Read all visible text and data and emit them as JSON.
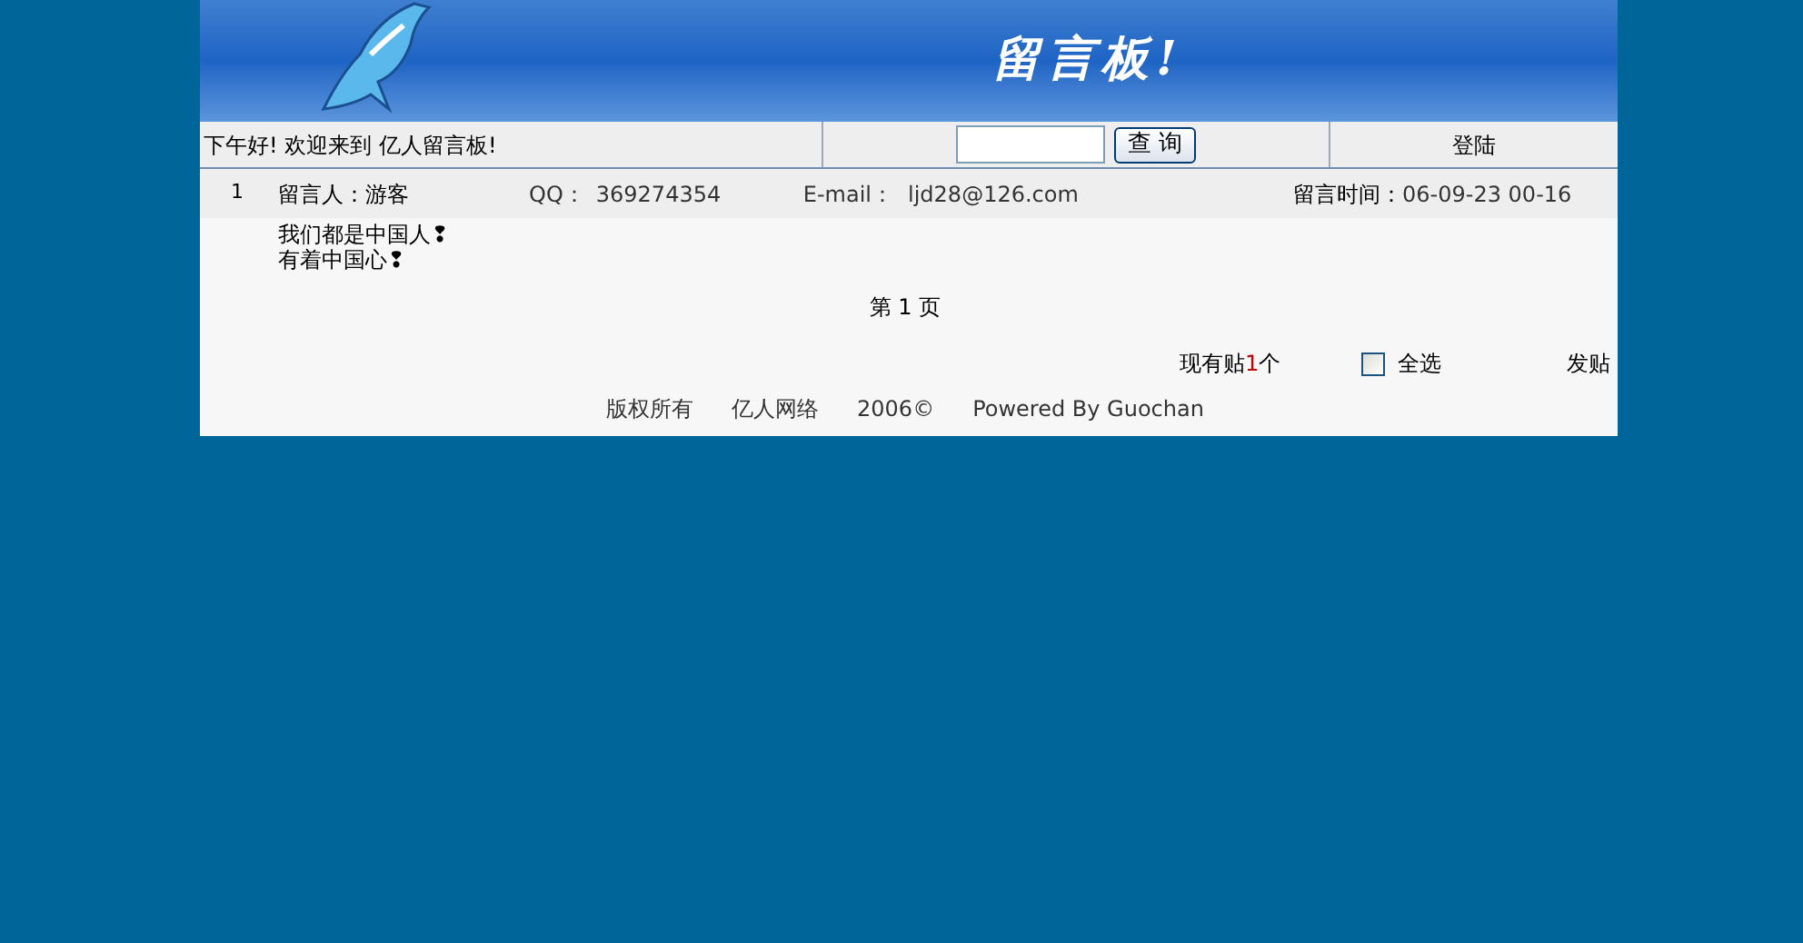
{
  "banner": {
    "title": "留言板!"
  },
  "nav": {
    "greeting": "下午好! 欢迎来到 亿人留言板!",
    "search": {
      "button": "查 询"
    },
    "login": "登陆"
  },
  "posts": [
    {
      "index": "1",
      "author": "留言人：游客",
      "qq_label": "QQ：",
      "qq": "369274354",
      "email_label": "E-mail：",
      "email": "ljd28@126.com",
      "time_label": "留言时间：",
      "time": "06-09-23 00-16",
      "lines": [
        "我们都是中国人❢",
        "有着中国心❢"
      ]
    }
  ],
  "pagination": "第 1 页",
  "summary": {
    "prefix": "现有贴",
    "count": "1",
    "suffix": "个",
    "select_all": {
      "label": "全选",
      "checked": false
    },
    "post_link": "发贴"
  },
  "footer": [
    "版权所有",
    "亿人网络",
    "2006©",
    "Powered By Guochan"
  ]
}
